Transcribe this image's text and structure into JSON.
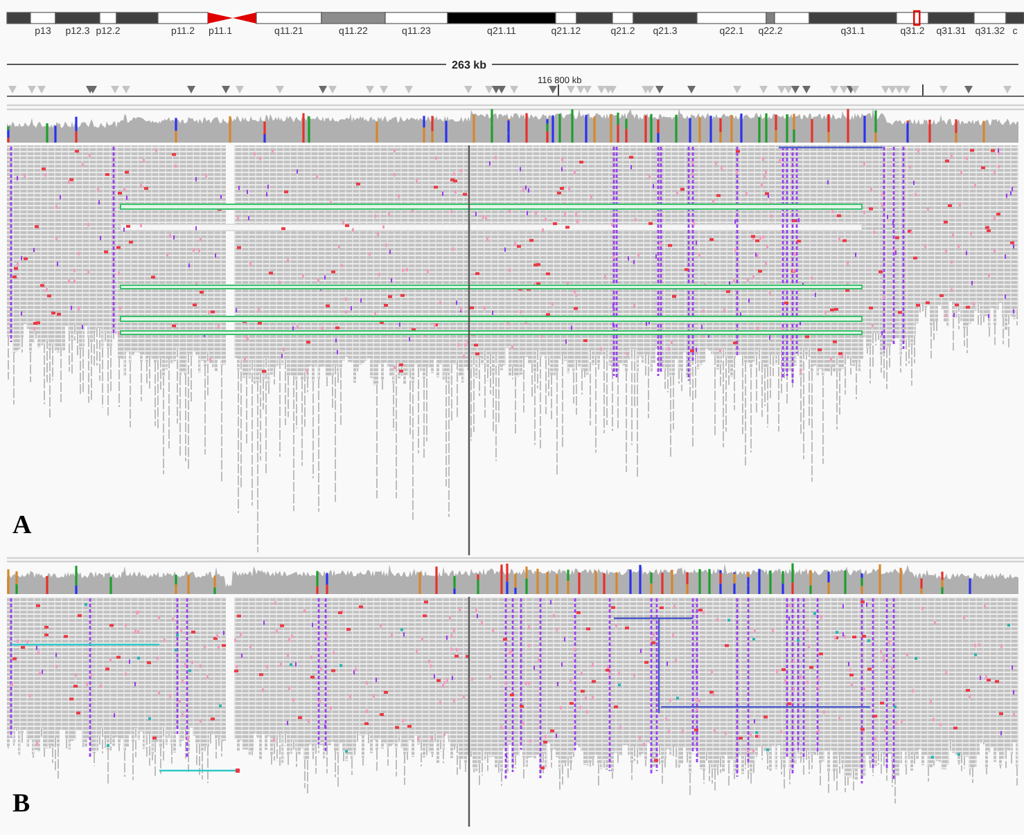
{
  "ideogram": {
    "bands": [
      {
        "kind": "band",
        "color": "#404040",
        "highlighted": false
      },
      {
        "kind": "band",
        "label": "p13",
        "color": "#ffffff",
        "highlighted": false
      },
      {
        "kind": "band",
        "label": "p12.3",
        "color": "#404040",
        "highlighted": false
      },
      {
        "kind": "band",
        "label": "p12.2",
        "color": "#ffffff",
        "highlighted": false
      },
      {
        "kind": "band",
        "color": "#404040",
        "highlighted": false
      },
      {
        "kind": "band",
        "label": "p11.2",
        "color": "#ffffff",
        "highlighted": false
      },
      {
        "kind": "centromere",
        "label": "p11.1",
        "highlighted": false
      },
      {
        "kind": "centromere",
        "highlighted": false
      },
      {
        "kind": "band",
        "label": "q11.21",
        "color": "#ffffff",
        "highlighted": false
      },
      {
        "kind": "band",
        "label": "q11.22",
        "color": "#8c8c8c",
        "highlighted": false
      },
      {
        "kind": "band",
        "label": "q11.23",
        "color": "#ffffff",
        "highlighted": false
      },
      {
        "kind": "band",
        "label": "q21.11",
        "color": "#000000",
        "highlighted": false
      },
      {
        "kind": "band",
        "label": "q21.12",
        "color": "#ffffff",
        "highlighted": false
      },
      {
        "kind": "band",
        "color": "#404040",
        "highlighted": false
      },
      {
        "kind": "band",
        "label": "q21.2",
        "color": "#ffffff",
        "highlighted": false
      },
      {
        "kind": "band",
        "label": "q21.3",
        "color": "#404040",
        "highlighted": false
      },
      {
        "kind": "band",
        "label": "q22.1",
        "color": "#ffffff",
        "highlighted": false
      },
      {
        "kind": "band",
        "label": "q22.2",
        "color": "#808080",
        "highlighted": false
      },
      {
        "kind": "band",
        "color": "#ffffff",
        "highlighted": false
      },
      {
        "kind": "band",
        "label": "q31.1",
        "color": "#404040",
        "highlighted": false
      },
      {
        "kind": "band",
        "label": "q31.2",
        "color": "#ffffff",
        "highlighted": true
      },
      {
        "kind": "band",
        "label": "q31.31",
        "color": "#404040",
        "highlighted": false
      },
      {
        "kind": "band",
        "label": "q31.32",
        "color": "#ffffff",
        "highlighted": false
      },
      {
        "kind": "band",
        "label": "c",
        "color": "#404040",
        "highlighted": false
      }
    ]
  },
  "ruler": {
    "span": "263 kb",
    "position": "116 800 kb"
  },
  "panels": [
    {
      "label": "A"
    },
    {
      "label": "B"
    }
  ]
}
